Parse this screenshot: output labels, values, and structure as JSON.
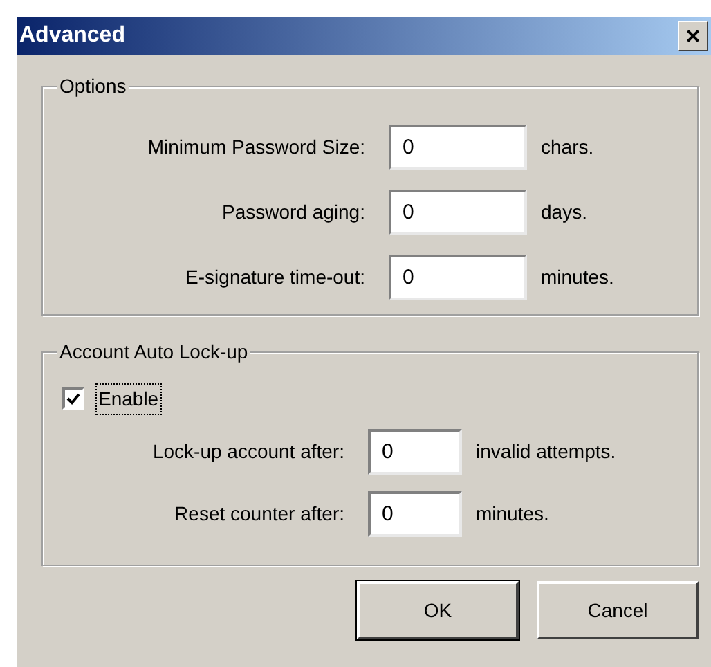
{
  "window": {
    "title": "Advanced",
    "close": "×"
  },
  "options": {
    "legend": "Options",
    "rows": [
      {
        "label": "Minimum Password Size:",
        "value": "0",
        "unit": "chars."
      },
      {
        "label": "Password aging:",
        "value": "0",
        "unit": "days."
      },
      {
        "label": "E-signature time-out:",
        "value": "0",
        "unit": "minutes."
      }
    ]
  },
  "lockup": {
    "legend": "Account Auto Lock-up",
    "enable": {
      "label": "Enable",
      "checked": true
    },
    "rows": [
      {
        "label": "Lock-up account after:",
        "value": "0",
        "unit": "invalid attempts."
      },
      {
        "label": "Reset counter after:",
        "value": "0",
        "unit": "minutes."
      }
    ]
  },
  "buttons": [
    {
      "label": "OK",
      "default": true
    },
    {
      "label": "Cancel",
      "default": false
    }
  ]
}
